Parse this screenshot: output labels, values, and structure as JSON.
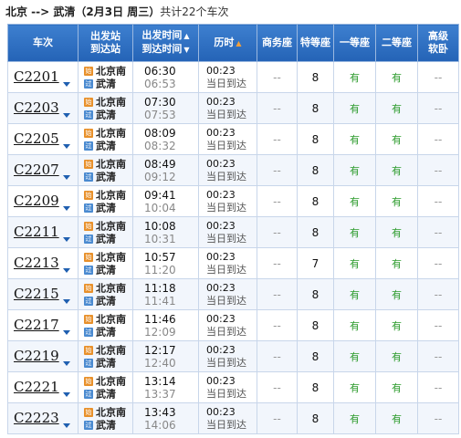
{
  "route": {
    "title": "北京 --> 武清（2月3日 周三）",
    "count": "共计22个车次"
  },
  "headers": {
    "train": "车次",
    "station_top": "出发站",
    "station_bottom": "到达站",
    "time_top": "出发时间",
    "time_bottom": "到达时间",
    "duration": "历时",
    "business": "商务座",
    "special": "特等座",
    "first": "一等座",
    "second": "二等座",
    "soft_top": "高级",
    "soft_bottom": "软卧"
  },
  "icons": {
    "start_badge": "始",
    "end_badge": "过"
  },
  "colors": {
    "header_bg": "#2463b6",
    "available": "#2a9a2a",
    "start_badge": "#e8902a",
    "end_badge": "#4a8ad0"
  },
  "trains": [
    {
      "no": "C2201",
      "from": "北京南",
      "to": "武清",
      "dep": "06:30",
      "arr": "06:53",
      "dur": "00:23",
      "same_day": "当日到达",
      "business": "--",
      "special": "8",
      "first": "有",
      "second": "有",
      "soft": "--"
    },
    {
      "no": "C2203",
      "from": "北京南",
      "to": "武清",
      "dep": "07:30",
      "arr": "07:53",
      "dur": "00:23",
      "same_day": "当日到达",
      "business": "--",
      "special": "8",
      "first": "有",
      "second": "有",
      "soft": "--"
    },
    {
      "no": "C2205",
      "from": "北京南",
      "to": "武清",
      "dep": "08:09",
      "arr": "08:32",
      "dur": "00:23",
      "same_day": "当日到达",
      "business": "--",
      "special": "8",
      "first": "有",
      "second": "有",
      "soft": "--"
    },
    {
      "no": "C2207",
      "from": "北京南",
      "to": "武清",
      "dep": "08:49",
      "arr": "09:12",
      "dur": "00:23",
      "same_day": "当日到达",
      "business": "--",
      "special": "8",
      "first": "有",
      "second": "有",
      "soft": "--"
    },
    {
      "no": "C2209",
      "from": "北京南",
      "to": "武清",
      "dep": "09:41",
      "arr": "10:04",
      "dur": "00:23",
      "same_day": "当日到达",
      "business": "--",
      "special": "8",
      "first": "有",
      "second": "有",
      "soft": "--"
    },
    {
      "no": "C2211",
      "from": "北京南",
      "to": "武清",
      "dep": "10:08",
      "arr": "10:31",
      "dur": "00:23",
      "same_day": "当日到达",
      "business": "--",
      "special": "8",
      "first": "有",
      "second": "有",
      "soft": "--"
    },
    {
      "no": "C2213",
      "from": "北京南",
      "to": "武清",
      "dep": "10:57",
      "arr": "11:20",
      "dur": "00:23",
      "same_day": "当日到达",
      "business": "--",
      "special": "7",
      "first": "有",
      "second": "有",
      "soft": "--"
    },
    {
      "no": "C2215",
      "from": "北京南",
      "to": "武清",
      "dep": "11:18",
      "arr": "11:41",
      "dur": "00:23",
      "same_day": "当日到达",
      "business": "--",
      "special": "8",
      "first": "有",
      "second": "有",
      "soft": "--"
    },
    {
      "no": "C2217",
      "from": "北京南",
      "to": "武清",
      "dep": "11:46",
      "arr": "12:09",
      "dur": "00:23",
      "same_day": "当日到达",
      "business": "--",
      "special": "8",
      "first": "有",
      "second": "有",
      "soft": "--"
    },
    {
      "no": "C2219",
      "from": "北京南",
      "to": "武清",
      "dep": "12:17",
      "arr": "12:40",
      "dur": "00:23",
      "same_day": "当日到达",
      "business": "--",
      "special": "8",
      "first": "有",
      "second": "有",
      "soft": "--"
    },
    {
      "no": "C2221",
      "from": "北京南",
      "to": "武清",
      "dep": "13:14",
      "arr": "13:37",
      "dur": "00:23",
      "same_day": "当日到达",
      "business": "--",
      "special": "8",
      "first": "有",
      "second": "有",
      "soft": "--"
    },
    {
      "no": "C2223",
      "from": "北京南",
      "to": "武清",
      "dep": "13:43",
      "arr": "14:06",
      "dur": "00:23",
      "same_day": "当日到达",
      "business": "--",
      "special": "8",
      "first": "有",
      "second": "有",
      "soft": "--"
    }
  ]
}
